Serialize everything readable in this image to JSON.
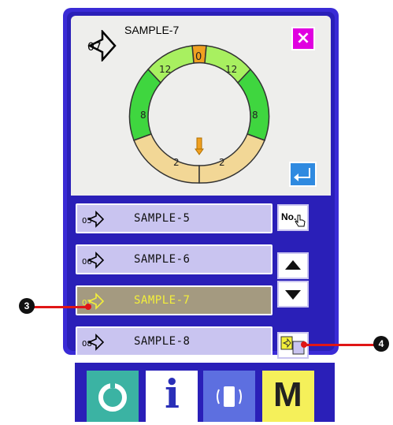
{
  "header": {
    "pattern_number": "07",
    "pattern_name": "SAMPLE-7",
    "close_label": "×"
  },
  "ring": {
    "segment_labels": [
      "0",
      "12",
      "12",
      "8",
      "8",
      "2",
      "2"
    ]
  },
  "list": {
    "rows": [
      {
        "number": "05",
        "label": "SAMPLE-5"
      },
      {
        "number": "06",
        "label": "SAMPLE-6"
      },
      {
        "number": "07",
        "label": "SAMPLE-7"
      },
      {
        "number": "08",
        "label": "SAMPLE-8"
      }
    ],
    "no_button_label": "No."
  },
  "callouts": {
    "left": "3",
    "right": "4"
  },
  "bottom_bar": {
    "mode_label": "M",
    "info_label": "i"
  },
  "colors": {
    "frame": "#3a2bd6",
    "screen": "#2a1fb8",
    "row_bg": "#c9c4f0",
    "row_selected_bg": "#a49a80",
    "row_selected_text": "#f3ef3a",
    "close": "#e000e0",
    "enter": "#2f8ae0",
    "ring_green": "#3fd63f",
    "ring_orange": "#f0a020",
    "ring_sand": "#f2d796",
    "ring_lime": "#a8f060",
    "callout_line": "#e01616"
  }
}
